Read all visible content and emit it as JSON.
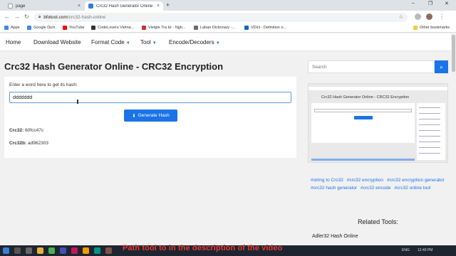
{
  "browser": {
    "tabs": [
      {
        "label": "page",
        "close": "×"
      },
      {
        "label": "Crc32 Hash Generator Online - CRC3",
        "close": "×"
      }
    ],
    "new_tab": "+",
    "window_controls": [
      "–",
      "❐",
      "✕"
    ],
    "url_host": "bfotool.com",
    "url_path": "/crc32-hash-online",
    "bookmarks": [
      {
        "label": "Apps",
        "color": "#4285f4"
      },
      {
        "label": "Google Dịch",
        "color": "#4285f4"
      },
      {
        "label": "YouTube",
        "color": "#ff0000"
      },
      {
        "label": "CodeLovers Vietna...",
        "color": "#333333"
      },
      {
        "label": "Vietgle Tra từ - Ngh...",
        "color": "#d32f2f"
      },
      {
        "label": "Laban Dictionary -...",
        "color": "#6c6c6c"
      },
      {
        "label": "VDict - Definition o...",
        "color": "#1565c0"
      },
      {
        "label": "Other bookmarks",
        "color": "#f2c744"
      }
    ]
  },
  "nav": {
    "items": [
      {
        "label": "Home",
        "caret": ""
      },
      {
        "label": "Download Website",
        "caret": ""
      },
      {
        "label": "Format Code",
        "caret": "▼"
      },
      {
        "label": "Tool",
        "caret": "▼"
      },
      {
        "label": "Encode/Decoders",
        "caret": "▼"
      }
    ]
  },
  "main": {
    "title": "Crc32 Hash Generator Online - CRC32 Encryption",
    "input_label": "Enter a word here to get its hash:",
    "input_value": "ddddddd",
    "button_label": "Generate Hash",
    "results": [
      {
        "label": "Crc32:",
        "value": "60fcc47c"
      },
      {
        "label": "Crc32b:",
        "value": "ad962303"
      }
    ]
  },
  "sidebar": {
    "search_placeholder": "Search",
    "thumb_title": "Crc32 Hash Generator Online - CRC32 Encryption",
    "tags": [
      "#string to Crc32",
      "#crc32 encryption",
      "#crc32 encryption generator",
      "#crc32 hash generator",
      "#crc32 encode",
      "#crc32 online tool"
    ],
    "related_title": "Related Tools:",
    "related_items": [
      "Adler32 Hash Online"
    ]
  },
  "overlay": {
    "caption": "Path tool to in the description of the video"
  },
  "taskbar": {
    "tray_text": "ENG",
    "time": "12:49 PM"
  },
  "colors": {
    "accent": "#1a73e8",
    "caption": "#e53935"
  }
}
